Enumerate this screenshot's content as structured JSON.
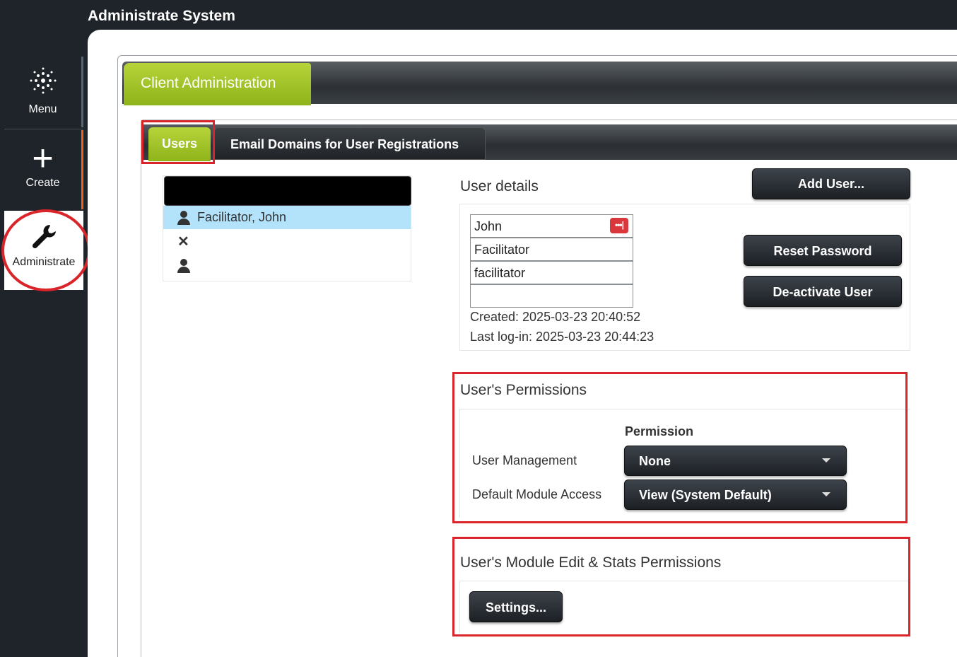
{
  "app": {
    "title": "Administrate System"
  },
  "sidebar": {
    "items": [
      {
        "label": "Menu",
        "icon": "snowflake-menu-icon"
      },
      {
        "label": "Create",
        "icon": "plus-icon",
        "glyph": "+"
      },
      {
        "label": "Administrate",
        "icon": "wrench-icon",
        "active": true
      }
    ]
  },
  "tabs": {
    "main": "Client Administration",
    "sub": [
      "Users",
      "Email Domains for User Registrations"
    ]
  },
  "users": {
    "list": [
      {
        "name": "Facilitator, John",
        "icon": "person-icon",
        "selected": true
      },
      {
        "name": "",
        "icon": "x-icon",
        "glyph": "✕"
      },
      {
        "name": "",
        "icon": "person-icon"
      }
    ]
  },
  "user_details": {
    "title": "User details",
    "add_user": "Add User...",
    "first_name": "John",
    "last_name": "Facilitator",
    "username": "facilitator",
    "email": "",
    "password_badge": "•••|",
    "created": "Created: 2025-03-23 20:40:52",
    "last_login": "Last log-in: 2025-03-23 20:44:23",
    "reset_password": "Reset Password",
    "deactivate": "De-activate User"
  },
  "permissions": {
    "title": "User's Permissions",
    "header": "Permission",
    "rows": [
      {
        "label": "User Management",
        "value": "None"
      },
      {
        "label": "Default Module Access",
        "value": "View (System Default)"
      }
    ]
  },
  "module_permissions": {
    "title": "User's Module Edit & Stats Permissions",
    "settings": "Settings..."
  },
  "colors": {
    "accent_green": "#9cc31f",
    "highlight_red": "#d9252a",
    "dark_bg": "#1f242a",
    "selected_row": "#b3e2fb"
  }
}
